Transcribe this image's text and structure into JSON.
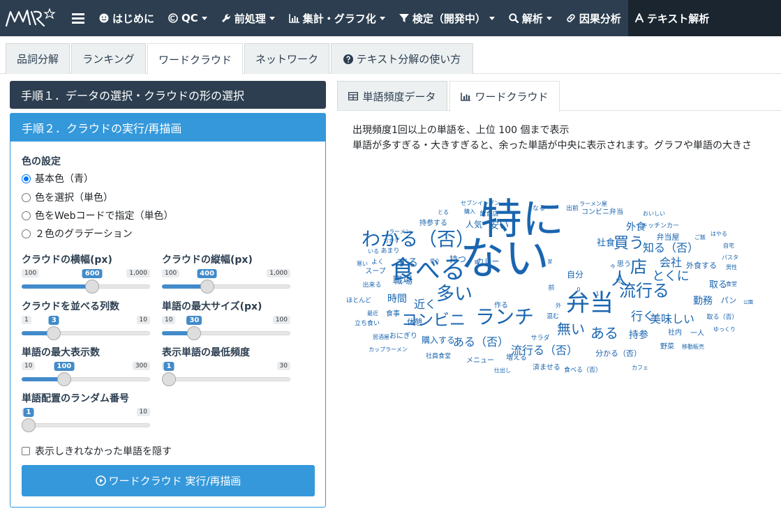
{
  "nav": {
    "logo": "MMR",
    "items": [
      {
        "label": "はじめに",
        "icon": "smile-icon",
        "caret": false
      },
      {
        "label": "QC",
        "icon": "copyright-icon",
        "caret": true
      },
      {
        "label": "前処理",
        "icon": "wrench-icon",
        "caret": true
      },
      {
        "label": "集計・グラフ化",
        "icon": "bar-chart-icon",
        "caret": true
      },
      {
        "label": "検定（開発中）",
        "icon": "filter-icon",
        "caret": true
      },
      {
        "label": "解析",
        "icon": "search-icon",
        "caret": true
      },
      {
        "label": "因果分析",
        "icon": "link-icon",
        "caret": false
      },
      {
        "label": "テキスト解析",
        "icon": "font-icon",
        "caret": false
      }
    ]
  },
  "tabs": [
    {
      "label": "品詞分解"
    },
    {
      "label": "ランキング"
    },
    {
      "label": "ワードクラウド"
    },
    {
      "label": "ネットワーク"
    },
    {
      "label": "テキスト分解の使い方",
      "icon": "question-icon"
    }
  ],
  "left": {
    "step1": "手順１．データの選択・クラウドの形の選択",
    "step2": "手順２．クラウドの実行/再描画",
    "color_label": "色の設定",
    "color_options": [
      "基本色（青）",
      "色を選択（単色）",
      "色をWebコードで指定（単色）",
      "２色のグラデーション"
    ],
    "sliders": [
      {
        "label": "クラウドの横幅(px)",
        "min": "100",
        "max": "1,000",
        "value": "600",
        "fraction": 0.556
      },
      {
        "label": "クラウドの縦幅(px)",
        "min": "100",
        "max": "1,000",
        "value": "400",
        "fraction": 0.333
      },
      {
        "label": "クラウドを並べる列数",
        "min": "1",
        "max": "10",
        "value": "3",
        "fraction": 0.222
      },
      {
        "label": "単語の最大サイズ(px)",
        "min": "10",
        "max": "100",
        "value": "30",
        "fraction": 0.222
      },
      {
        "label": "単語の最大表示数",
        "min": "10",
        "max": "300",
        "value": "100",
        "fraction": 0.31
      },
      {
        "label": "表示単語の最低頻度",
        "min": "1",
        "max": "30",
        "value": "1",
        "fraction": 0.0
      },
      {
        "label": "単語配置のランダム番号",
        "min": "1",
        "max": "10",
        "value": "1",
        "fraction": 0.0
      }
    ],
    "hide_label": "表示しきれなかった単語を隠す",
    "run_label": "ワードクラウド 実行/再描画"
  },
  "right": {
    "tabs": [
      {
        "label": "単語頻度データ",
        "icon": "table-icon"
      },
      {
        "label": "ワードクラウド",
        "icon": "bar-chart-icon"
      }
    ],
    "info1": "出現頻度1回以上の単語を、上位 100 個まで表示",
    "info2": "単語が多すぎる・大きすぎると、余った単語が中央に表示されます。グラフや単語の大きさ",
    "words": [
      {
        "t": "特に",
        "s": 60
      },
      {
        "t": "ない",
        "s": 64
      },
      {
        "t": "食べる",
        "s": 36
      },
      {
        "t": "わかる（否）",
        "s": 27
      },
      {
        "t": "弁当",
        "s": 34
      },
      {
        "t": "ランチ",
        "s": 28
      },
      {
        "t": "コンビニ",
        "s": 23
      },
      {
        "t": "多い",
        "s": 26
      },
      {
        "t": "流行る",
        "s": 24
      },
      {
        "t": "買う",
        "s": 22
      },
      {
        "t": "店",
        "s": 24
      },
      {
        "t": "人",
        "s": 24
      },
      {
        "t": "無い",
        "s": 20
      },
      {
        "t": "ある",
        "s": 20
      },
      {
        "t": "知る（否）",
        "s": 16
      },
      {
        "t": "とくに",
        "s": 18
      },
      {
        "t": "行く",
        "s": 17
      },
      {
        "t": "美味しい",
        "s": 16
      },
      {
        "t": "流行る（否）",
        "s": 16
      },
      {
        "t": "ある（否）",
        "s": 16
      },
      {
        "t": "会社",
        "s": 16
      },
      {
        "t": "近く",
        "s": 16
      },
      {
        "t": "外食",
        "s": 14
      },
      {
        "t": "社食",
        "s": 13
      },
      {
        "t": "安い",
        "s": 14
      },
      {
        "t": "する",
        "s": 15
      },
      {
        "t": "職場",
        "s": 14
      },
      {
        "t": "時間",
        "s": 14
      },
      {
        "t": "勤務",
        "s": 14
      },
      {
        "t": "取る",
        "s": 13
      },
      {
        "t": "持参",
        "s": 14
      },
      {
        "t": "自分",
        "s": 12
      },
      {
        "t": "人気",
        "s": 12
      },
      {
        "t": "持つ",
        "s": 12
      },
      {
        "t": "カレー",
        "s": 11
      },
      {
        "t": "外食する",
        "s": 11
      },
      {
        "t": "パン",
        "s": 11
      },
      {
        "t": "弁当屋",
        "s": 11
      },
      {
        "t": "思う",
        "s": 10
      },
      {
        "t": "分かる（否）",
        "s": 11
      },
      {
        "t": "購入する",
        "s": 12
      },
      {
        "t": "休憩",
        "s": 11
      },
      {
        "t": "食事",
        "s": 10
      },
      {
        "t": "おにぎり",
        "s": 10
      },
      {
        "t": "スープ",
        "s": 10
      },
      {
        "t": "作る",
        "s": 10
      },
      {
        "t": "混む",
        "s": 9
      },
      {
        "t": "社内",
        "s": 10
      },
      {
        "t": "一人",
        "s": 10
      },
      {
        "t": "野菜",
        "s": 10
      },
      {
        "t": "サラダ",
        "s": 9
      },
      {
        "t": "メニュー",
        "s": 10
      },
      {
        "t": "増える",
        "s": 10
      },
      {
        "t": "済ませる",
        "s": 10
      },
      {
        "t": "食べる（否）",
        "s": 9
      },
      {
        "t": "社員食堂",
        "s": 9
      },
      {
        "t": "仕出し",
        "s": 8
      },
      {
        "t": "カフェ",
        "s": 8
      },
      {
        "t": "移動販売",
        "s": 8
      },
      {
        "t": "取る（否）",
        "s": 9
      },
      {
        "t": "ゆっくり",
        "s": 8
      },
      {
        "t": "キッチンカー",
        "s": 9
      },
      {
        "t": "コンビニ弁当",
        "s": 10
      },
      {
        "t": "ラーメン屋",
        "s": 8
      },
      {
        "t": "出前",
        "s": 9
      },
      {
        "t": "おいしい",
        "s": 8
      },
      {
        "t": "なる",
        "s": 9
      },
      {
        "t": "セブンイレブン",
        "s": 8
      },
      {
        "t": "購入",
        "s": 8
      },
      {
        "t": "飲食店",
        "s": 9
      },
      {
        "t": "とる",
        "s": 8
      },
      {
        "t": "持参する",
        "s": 10
      },
      {
        "t": "ラーメン",
        "s": 8
      },
      {
        "t": "おかず",
        "s": 8
      },
      {
        "t": "いる",
        "s": 8
      },
      {
        "t": "あまり",
        "s": 9
      },
      {
        "t": "寒い",
        "s": 8
      },
      {
        "t": "よく",
        "s": 9
      },
      {
        "t": "出来る",
        "s": 9
      },
      {
        "t": "ほとんど",
        "s": 9
      },
      {
        "t": "最近",
        "s": 8
      },
      {
        "t": "立ち食い",
        "s": 9
      },
      {
        "t": "居酒屋",
        "s": 8
      },
      {
        "t": "カップラーメン",
        "s": 8
      },
      {
        "t": "ご飯",
        "s": 8
      },
      {
        "t": "はやる",
        "s": 8
      },
      {
        "t": "自宅",
        "s": 8
      },
      {
        "t": "パスタ",
        "s": 8
      },
      {
        "t": "男性",
        "s": 8
      },
      {
        "t": "食堂",
        "s": 8
      },
      {
        "t": "公園",
        "s": 7
      },
      {
        "t": "使う",
        "s": 7
      },
      {
        "t": "昼",
        "s": 7
      },
      {
        "t": "家",
        "s": 7
      },
      {
        "t": "今",
        "s": 7
      },
      {
        "t": "他",
        "s": 7
      },
      {
        "t": "前",
        "s": 9
      },
      {
        "t": "外",
        "s": 8
      },
      {
        "t": "0",
        "s": 8
      },
      {
        "t": "1",
        "s": 8
      }
    ]
  }
}
